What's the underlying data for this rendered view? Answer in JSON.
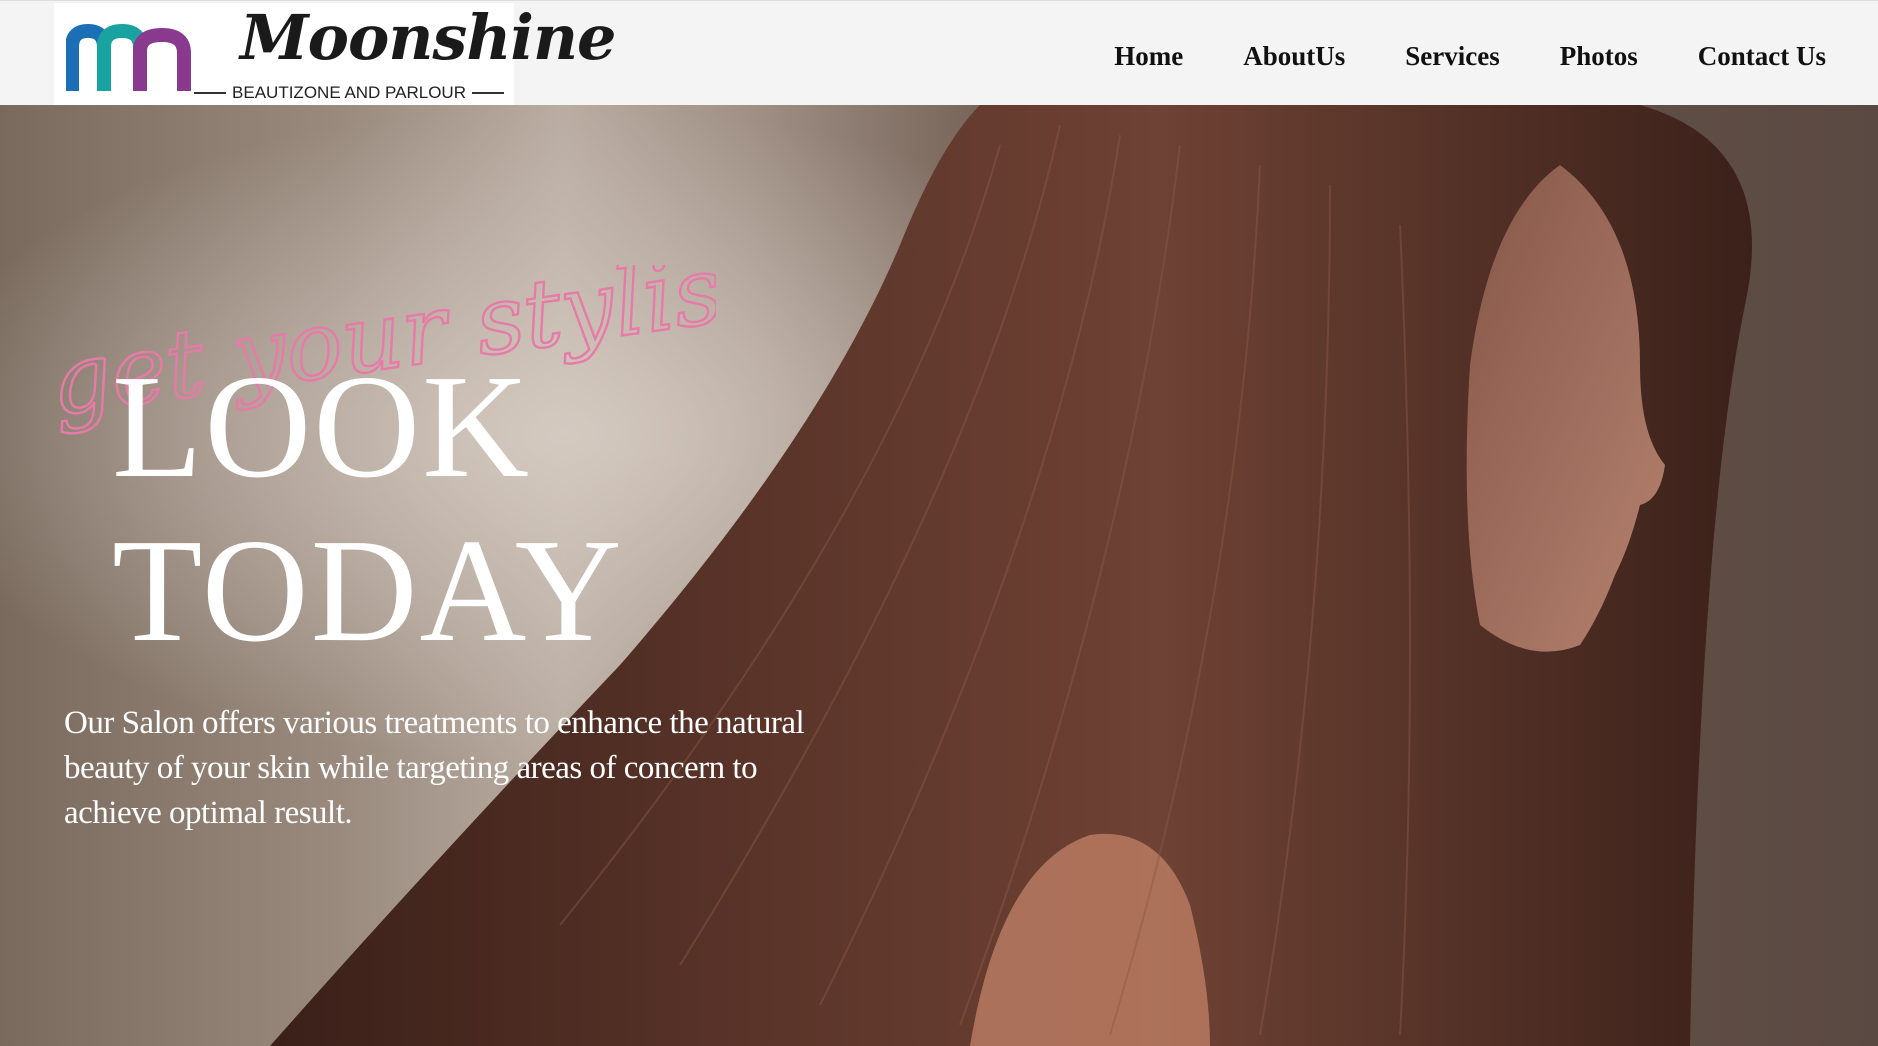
{
  "header": {
    "logo": {
      "word": "Moonshine",
      "tagline": "BEAUTIZONE AND PARLOUR",
      "icon": "m-monogram-logo"
    },
    "nav": [
      {
        "label": "Home"
      },
      {
        "label": "AboutUs"
      },
      {
        "label": "Services"
      },
      {
        "label": "Photos"
      },
      {
        "label": "Contact Us"
      }
    ]
  },
  "hero": {
    "script_text": "get your stylish",
    "headline_1": "LOOK",
    "headline_2": "TODAY",
    "description": "Our Salon offers various treatments to enhance the natural beauty of your skin while targeting areas of concern to achieve optimal result.",
    "image": "woman-long-brown-hair-photo"
  },
  "colors": {
    "accent_pink": "#e87aa8",
    "logo_blue": "#1c6fb5",
    "logo_teal": "#19a3a0",
    "logo_purple": "#8a3a8e",
    "nav_bg": "#f4f4f4"
  }
}
